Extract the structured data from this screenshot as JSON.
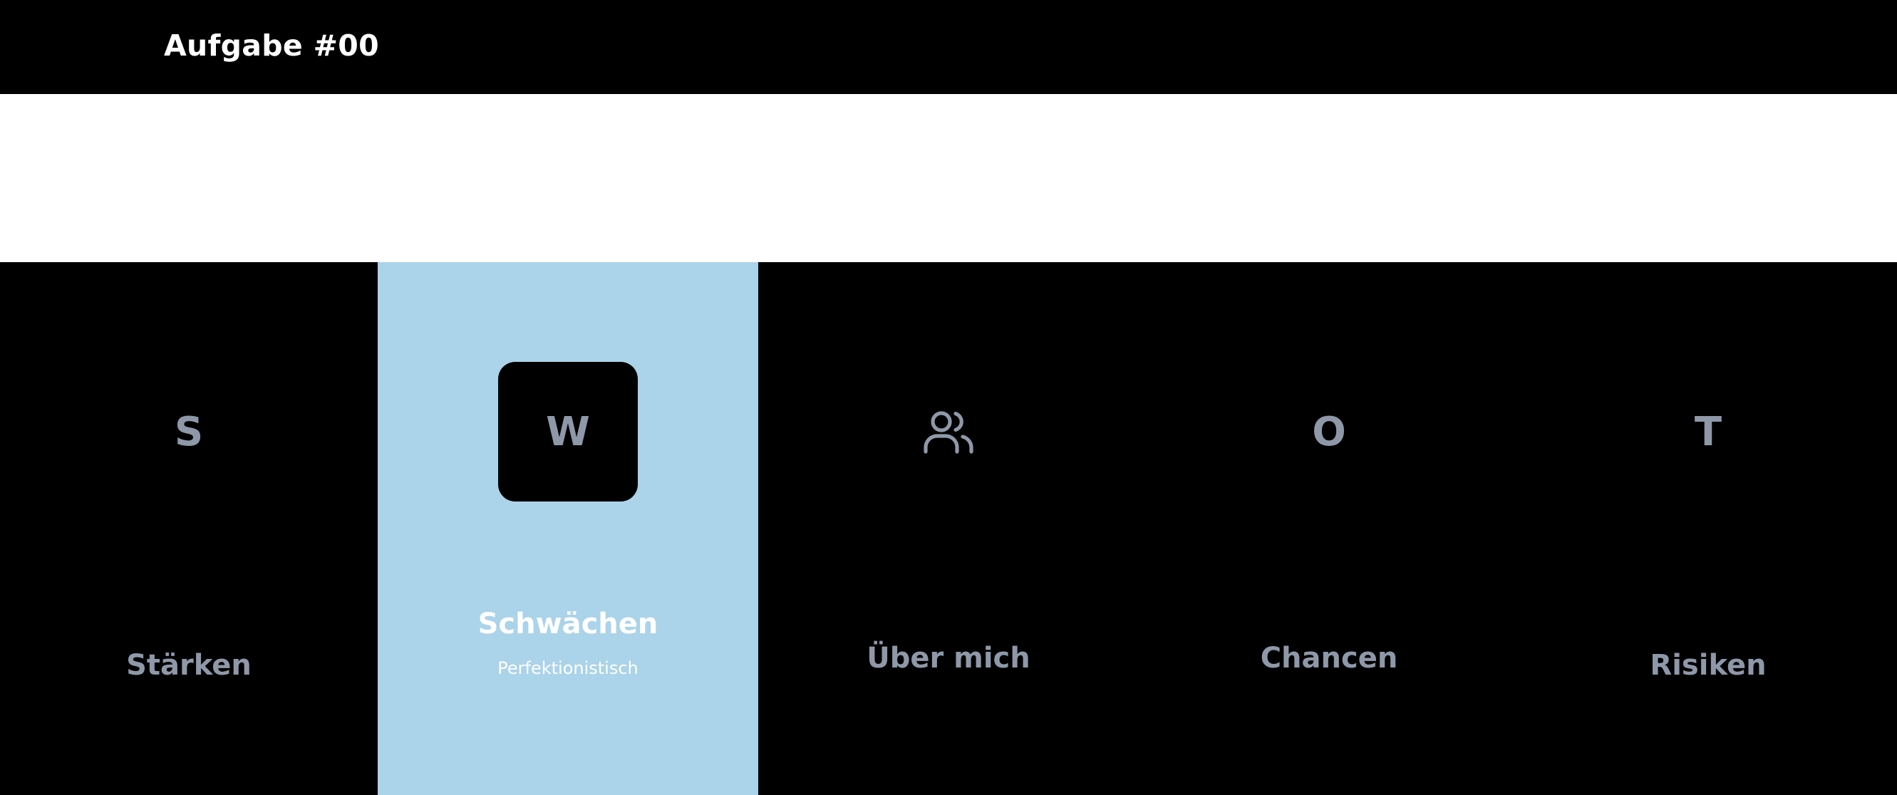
{
  "header": {
    "title": "Aufgabe #00"
  },
  "colors": {
    "background": "#000000",
    "banner": "#ffffff",
    "active_panel": "#abd3e9",
    "inactive_text": "#8e98a8",
    "active_text": "#ffffff"
  },
  "swot": {
    "panels": [
      {
        "letter": "S",
        "title": "Stärken",
        "active": false
      },
      {
        "letter": "W",
        "title": "Schwächen",
        "subtitle": "Perfektionistisch",
        "active": true
      },
      {
        "icon": "users-icon",
        "title": "Über mich",
        "active": false
      },
      {
        "letter": "O",
        "title": "Chancen",
        "active": false
      },
      {
        "letter": "T",
        "title": "Risiken",
        "active": false
      }
    ]
  }
}
